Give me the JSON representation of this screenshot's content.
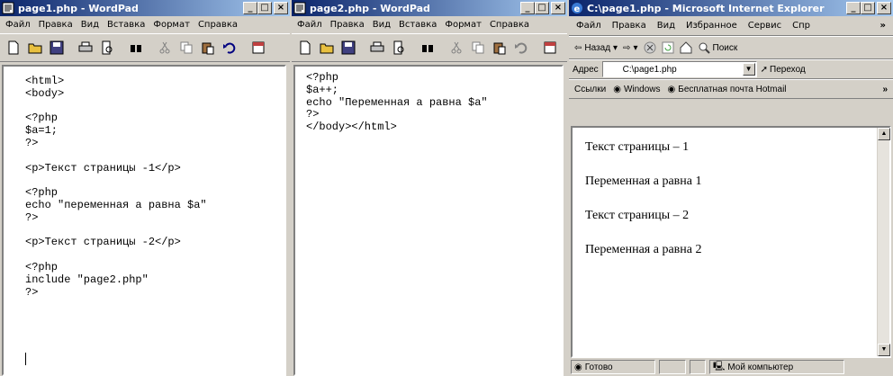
{
  "wordpad1": {
    "title": "page1.php - WordPad",
    "menu": [
      "Файл",
      "Правка",
      "Вид",
      "Вставка",
      "Формат",
      "Справка"
    ],
    "code": "<html>\n<body>\n\n<?php\n$a=1;\n?>\n\n<p>Текст страницы -1</p>\n\n<?php\necho \"переменная a равна $a\"\n?>\n\n<p>Текст страницы -2</p>\n\n<?php\ninclude \"page2.php\"\n?>"
  },
  "wordpad2": {
    "title": "page2.php - WordPad",
    "menu": [
      "Файл",
      "Правка",
      "Вид",
      "Вставка",
      "Формат",
      "Справка"
    ],
    "code": "<?php\n$a++;\necho \"Переменная a равна $a\"\n?>\n</body></html>"
  },
  "ie": {
    "title": "C:\\page1.php - Microsoft Internet Explorer",
    "menu": [
      "Файл",
      "Правка",
      "Вид",
      "Избранное",
      "Сервис",
      "Спр"
    ],
    "menu_more": "»",
    "back_label": "Назад",
    "search_label": "Поиск",
    "address_label": "Адрес",
    "address_value": "C:\\page1.php",
    "go_label": "Переход",
    "links_label": "Ссылки",
    "link_items": [
      "Windows",
      "Бесплатная почта Hotmail"
    ],
    "links_more": "»",
    "content": [
      "Текст страницы – 1",
      "Переменная a равна 1",
      "Текст страницы – 2",
      "Переменная a равна 2"
    ],
    "status_text": "Готово",
    "status_zone": "Мой компьютер"
  },
  "colors": {
    "titlebar_start": "#0a246a",
    "titlebar_end": "#a6caf0",
    "chrome": "#d4d0c8"
  }
}
